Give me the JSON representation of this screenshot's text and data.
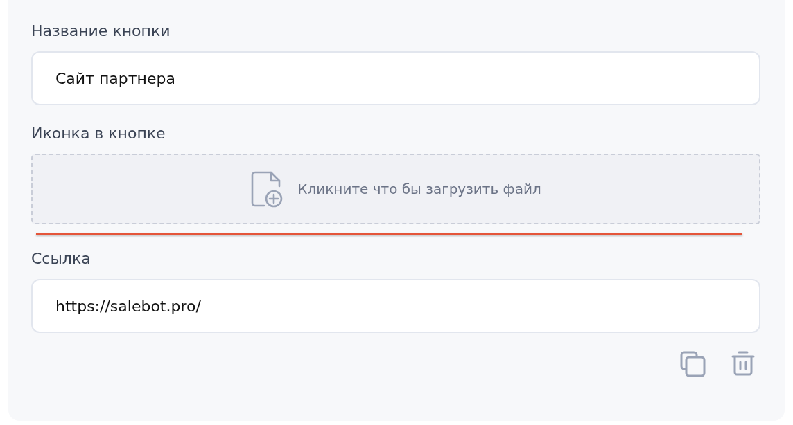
{
  "fields": [
    {
      "kind": "text",
      "label": "Название кнопки",
      "value": "Сайт партнера"
    },
    {
      "kind": "upload",
      "label": "Иконка в кнопке",
      "placeholder": "Кликните что бы загрузить файл"
    },
    {
      "kind": "text",
      "label": "Ссылка",
      "value": "https://salebot.pro/"
    }
  ]
}
